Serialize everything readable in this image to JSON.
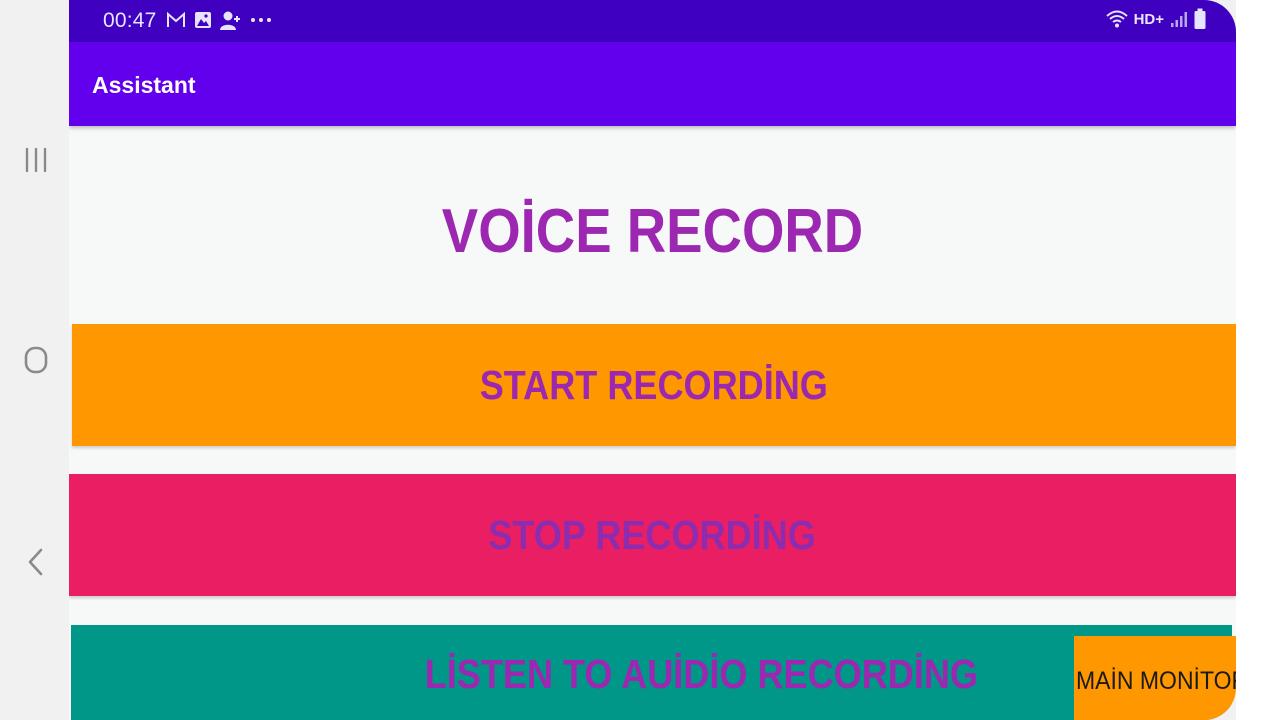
{
  "status_bar": {
    "time": "00:47",
    "left_icons": [
      "gmail-icon",
      "image-icon",
      "add-contact-icon",
      "more-dots-icon"
    ],
    "network_label": "HD+",
    "right_icons": [
      "wifi-icon",
      "signal-icon",
      "battery-icon"
    ]
  },
  "app_bar": {
    "title": "Assistant"
  },
  "main": {
    "heading": "VOİCE RECORD",
    "start_label": "START RECORDİNG",
    "stop_label": "STOP RECORDİNG",
    "listen_label": "LİSTEN TO AUİDİO RECORDİNG",
    "main_monitor_label": "MAİN MONİTOR"
  },
  "navigation": {
    "buttons": [
      "recent-apps-icon",
      "home-icon",
      "back-icon"
    ]
  },
  "colors": {
    "status_bar": "#3f00c0",
    "app_bar": "#6200ee",
    "heading_text": "#9c27b0",
    "start_button": "#ff9800",
    "stop_button": "#e91e63",
    "listen_button": "#009688",
    "main_monitor_button": "#ff9800"
  }
}
